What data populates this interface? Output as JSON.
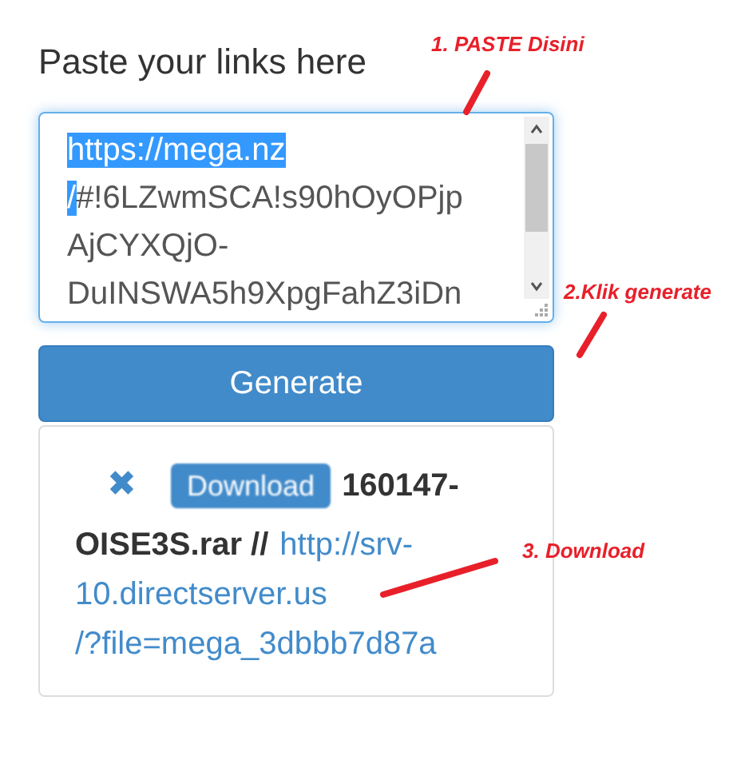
{
  "heading": "Paste your links here",
  "links_field": {
    "lines": [
      [
        {
          "text": "https://mega.nz",
          "selected": true
        }
      ],
      [
        {
          "text": "/",
          "selected": true
        },
        {
          "text": "#!6LZwmSCA!s90hOyOPjp",
          "selected": false
        }
      ],
      [
        {
          "text": "AjCYXQjO-",
          "selected": false
        }
      ],
      [
        {
          "text": "DuINSWA5h9XpgFahZ3iDn",
          "selected": false
        }
      ]
    ]
  },
  "generate_button": "Generate",
  "result": {
    "remove_icon": "✖",
    "download_button": "Download",
    "file_name_lines": [
      "160147-",
      "OISE3S.rar //"
    ],
    "link_lines": [
      "http://srv-",
      "10.directserver.us",
      "/?file=mega_3dbbb7d87a"
    ]
  },
  "annotations": [
    {
      "text": "1. PASTE Disini"
    },
    {
      "text": "2.Klik generate"
    },
    {
      "text": "3. Download"
    }
  ]
}
